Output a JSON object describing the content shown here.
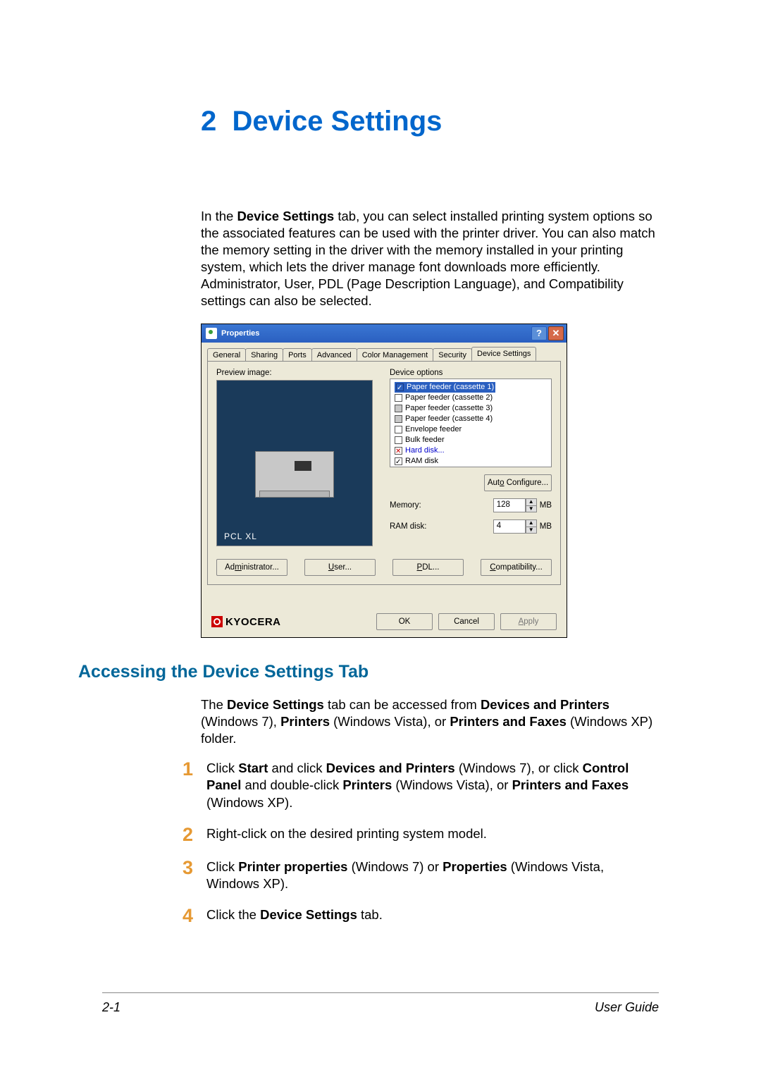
{
  "chapter": {
    "number": "2",
    "title": "Device Settings"
  },
  "intro": {
    "prefix": "In the ",
    "bold1": "Device Settings",
    "rest": " tab, you can select installed printing system options so the associated features can be used with the printer driver. You can also match the memory setting in the driver with the memory installed in your printing system, which lets the driver manage font downloads more efficiently. Administrator, User, PDL (Page Description Language), and Compatibility settings can also be selected."
  },
  "dialog": {
    "title": "Properties",
    "tabs": [
      "General",
      "Sharing",
      "Ports",
      "Advanced",
      "Color Management",
      "Security",
      "Device Settings"
    ],
    "active_tab_index": 6,
    "preview_label": "Preview image:",
    "preview_mode": "PCL XL",
    "device_options_label": "Device options",
    "options": [
      {
        "label": "Paper feeder (cassette 1)",
        "state": "checked-blue",
        "selected": true
      },
      {
        "label": "Paper feeder (cassette 2)",
        "state": "unchecked"
      },
      {
        "label": "Paper feeder (cassette 3)",
        "state": "gray"
      },
      {
        "label": "Paper feeder (cassette 4)",
        "state": "gray"
      },
      {
        "label": "Envelope feeder",
        "state": "unchecked"
      },
      {
        "label": "Bulk feeder",
        "state": "unchecked"
      },
      {
        "label": "Hard disk...",
        "state": "x-red",
        "link": true
      },
      {
        "label": "RAM disk",
        "state": "checked-tick"
      }
    ],
    "auto_configure_btn": "Auto Configure...",
    "memory_label": "Memory:",
    "memory_value": "128",
    "memory_unit": "MB",
    "ramdisk_label": "RAM disk:",
    "ramdisk_value": "4",
    "ramdisk_unit": "MB",
    "bottom_buttons": {
      "admin": "Administrator...",
      "user": "User...",
      "pdl": "PDL...",
      "compat": "Compatibility..."
    },
    "brand": "KYOCERA",
    "dlg_ok": "OK",
    "dlg_cancel": "Cancel",
    "dlg_apply": "Apply"
  },
  "section_heading": "Accessing the Device Settings Tab",
  "access_para": {
    "t1": "The ",
    "b1": "Device Settings",
    "t2": " tab can be accessed from ",
    "b2": "Devices and Printers",
    "t3": " (Windows 7), ",
    "b3": "Printers",
    "t4": " (Windows Vista), or ",
    "b4": "Printers and Faxes",
    "t5": " (Windows XP) folder."
  },
  "steps": {
    "s1": {
      "num": "1",
      "t1": "Click ",
      "b1": "Start",
      "t2": " and click ",
      "b2": "Devices and Printers",
      "t3": " (Windows 7), or click ",
      "b3": "Control Panel",
      "t4": " and double-click ",
      "b4": "Printers",
      "t5": " (Windows Vista), or ",
      "b5": "Printers and Faxes",
      "t6": " (Windows XP)."
    },
    "s2": {
      "num": "2",
      "text": "Right-click on the desired printing system model."
    },
    "s3": {
      "num": "3",
      "t1": "Click ",
      "b1": "Printer properties",
      "t2": " (Windows 7) or ",
      "b2": "Properties",
      "t3": " (Windows Vista, Windows XP)."
    },
    "s4": {
      "num": "4",
      "t1": "Click the ",
      "b1": "Device Settings",
      "t2": " tab."
    }
  },
  "footer": {
    "page": "2-1",
    "guide": "User Guide"
  }
}
